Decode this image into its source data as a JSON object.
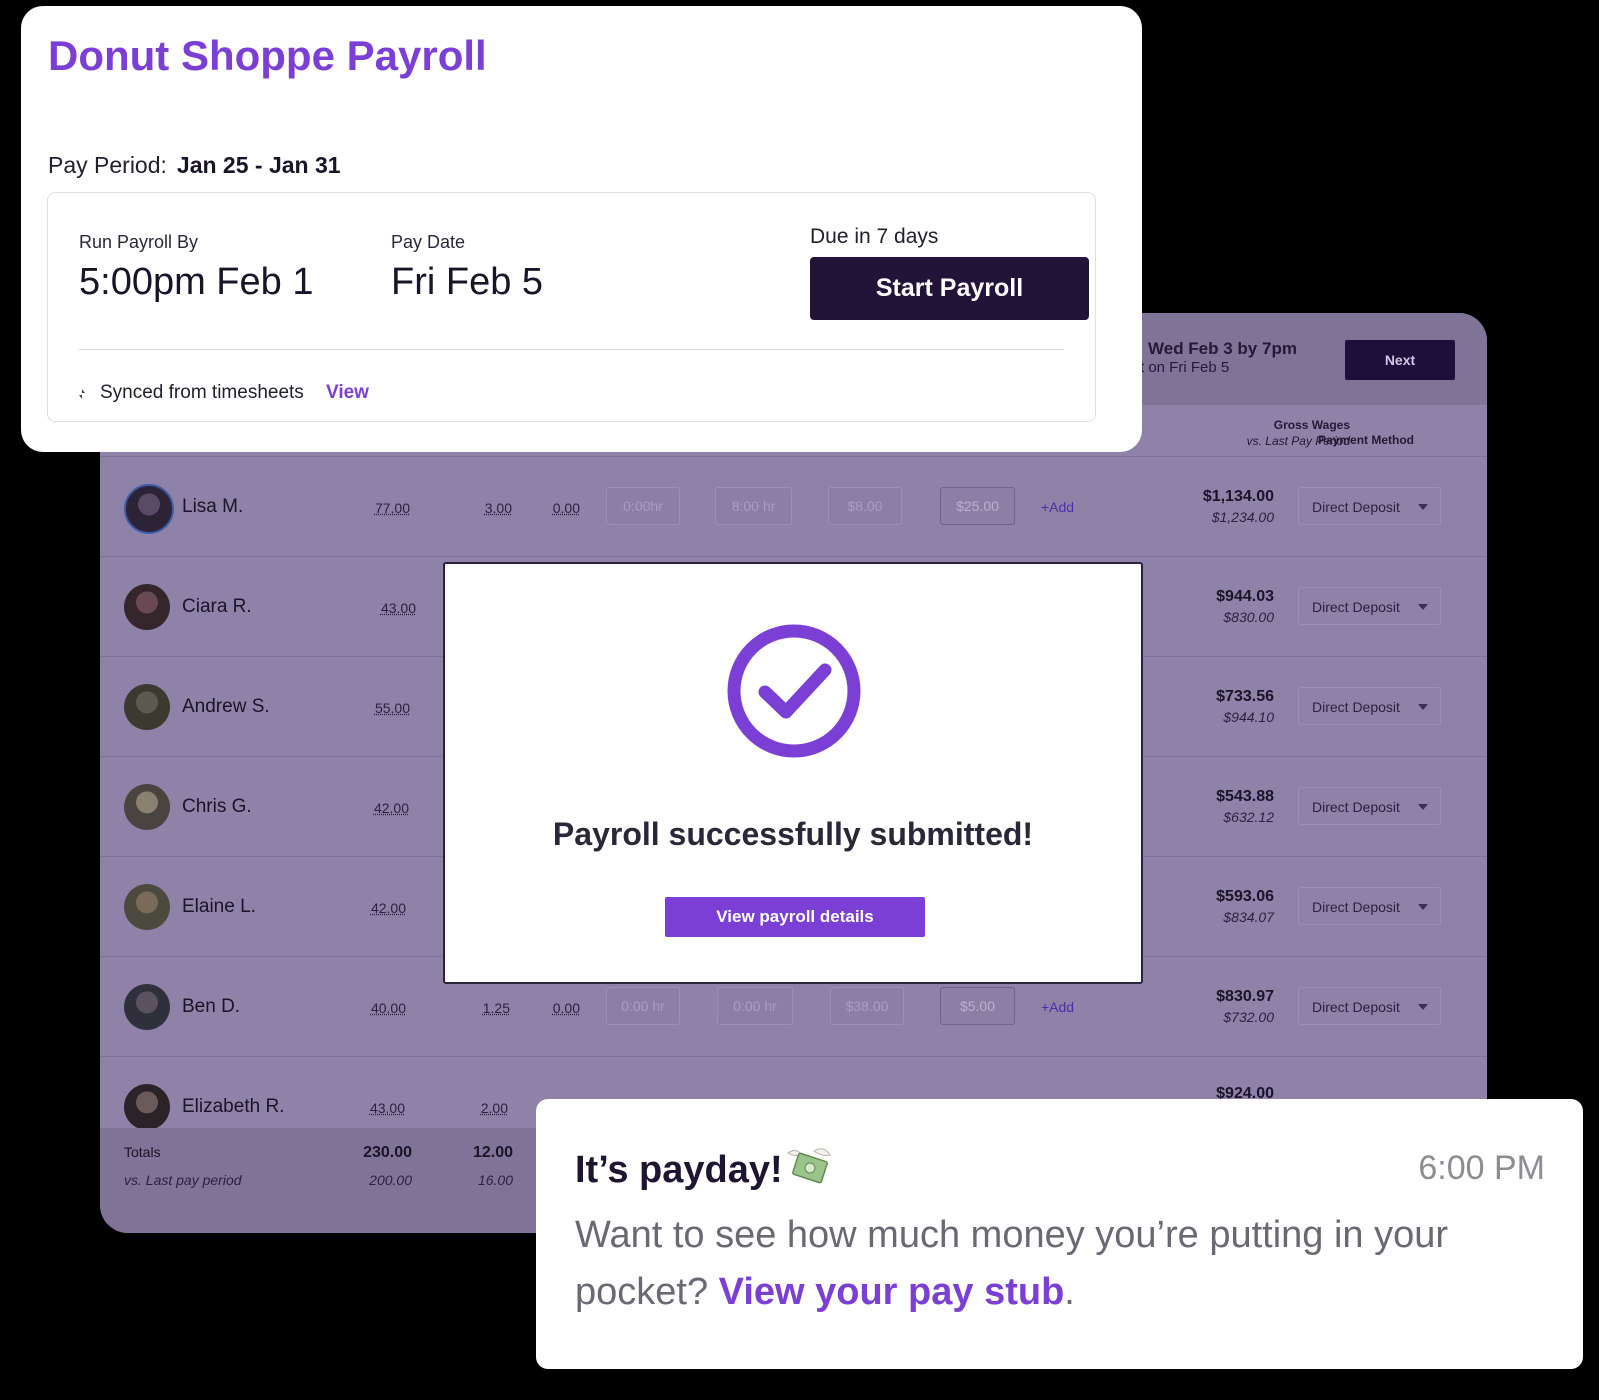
{
  "table": {
    "deadline_line1": "Wed Feb 3 by 7pm",
    "deadline_line2": "t on Fri Feb 5",
    "next_label": "Next",
    "col_gross": "Gross Wages",
    "col_gross_sub": "vs. Last Pay Period",
    "col_method": "Payment Method",
    "rows": [
      {
        "name": "Lisa M.",
        "hours": "77.00",
        "ot": "3.00",
        "dt": "0.00",
        "c1": "0:00hr",
        "c2": "8:00 hr",
        "c3": "$8.00",
        "tips": "$25.00",
        "add": "+Add",
        "gross": "$1,134.00",
        "gross_prev": "$1,234.00",
        "method": "Direct Deposit"
      },
      {
        "name": "Ciara R.",
        "hours": "43.00",
        "gross": "$944.03",
        "gross_prev": "$830.00",
        "method": "Direct Deposit"
      },
      {
        "name": "Andrew S.",
        "hours": "55.00",
        "gross": "$733.56",
        "gross_prev": "$944.10",
        "method": "Direct Deposit"
      },
      {
        "name": "Chris G.",
        "hours": "42.00",
        "gross": "$543.88",
        "gross_prev": "$632.12",
        "method": "Direct Deposit"
      },
      {
        "name": "Elaine L.",
        "hours": "42.00",
        "gross": "$593.06",
        "gross_prev": "$834.07",
        "method": "Direct Deposit"
      },
      {
        "name": "Ben D.",
        "hours": "40.00",
        "ot": "1.25",
        "dt": "0.00",
        "c1": "0:00 hr",
        "c2": "0:00 hr",
        "c3": "$38.00",
        "tips": "$5.00",
        "add": "+Add",
        "gross": "$830.97",
        "gross_prev": "$732.00",
        "method": "Direct Deposit"
      },
      {
        "name": "Elizabeth R.",
        "hours": "43.00",
        "ot": "2.00",
        "gross": "$924.00"
      }
    ],
    "totals": {
      "label": "Totals",
      "sub": "vs. Last pay period",
      "hours": "230.00",
      "hours_prev": "200.00",
      "ot": "12.00",
      "ot_prev": "16.00"
    }
  },
  "header": {
    "title": "Donut Shoppe Payroll",
    "pay_period_label": "Pay Period:",
    "pay_period_value": "Jan 25 - Jan 31",
    "run_by_label": "Run Payroll By",
    "run_by_value": "5:00pm Feb 1",
    "pay_date_label": "Pay Date",
    "pay_date_value": "Fri Feb 5",
    "due_text": "Due in 7 days",
    "start_button": "Start Payroll",
    "sync_text": "Synced from timesheets",
    "sync_link": "View"
  },
  "modal": {
    "title": "Payroll successfully submitted!",
    "button": "View payroll details"
  },
  "notification": {
    "title": "It’s payday!",
    "time": "6:00 PM",
    "body": "Want to see how much money you’re putting in your pocket?",
    "link": "View your pay stub",
    "end": "."
  },
  "colors": {
    "accent": "#7b3fd6",
    "dark": "#221339",
    "overlay": "#8e82a8"
  }
}
